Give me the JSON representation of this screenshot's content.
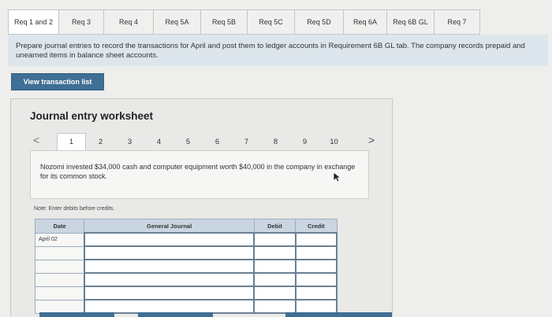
{
  "tabs": [
    {
      "label": "Req 1 and 2",
      "active": true
    },
    {
      "label": "Req 3",
      "active": false
    },
    {
      "label": "Req 4",
      "active": false
    },
    {
      "label": "Req 5A",
      "active": false
    },
    {
      "label": "Req 5B",
      "active": false
    },
    {
      "label": "Req 5C",
      "active": false
    },
    {
      "label": "Req 5D",
      "active": false
    },
    {
      "label": "Req 6A",
      "active": false
    },
    {
      "label": "Req 6B GL",
      "active": false
    },
    {
      "label": "Req 7",
      "active": false
    }
  ],
  "instructions": "Prepare journal entries to record the transactions for April and post them to ledger accounts in Requirement 6B GL tab. The company records prepaid and unearned items in balance sheet accounts.",
  "view_button_label": "View transaction list",
  "worksheet": {
    "title": "Journal entry worksheet",
    "prev_icon": "<",
    "next_icon": ">",
    "pages": [
      "1",
      "2",
      "3",
      "4",
      "5",
      "6",
      "7",
      "8",
      "9",
      "10"
    ],
    "active_page": "1",
    "transaction_text": "Nozomi invested $34,000 cash and computer equipment worth $40,000 in the company in exchange for its common stock.",
    "note": "Note: Enter debits before credits.",
    "table": {
      "headers": {
        "date": "Date",
        "account": "General Journal",
        "debit": "Debit",
        "credit": "Credit"
      },
      "rows": [
        {
          "date": "April 02",
          "account": "",
          "debit": "",
          "credit": ""
        },
        {
          "date": "",
          "account": "",
          "debit": "",
          "credit": ""
        },
        {
          "date": "",
          "account": "",
          "debit": "",
          "credit": ""
        },
        {
          "date": "",
          "account": "",
          "debit": "",
          "credit": ""
        },
        {
          "date": "",
          "account": "",
          "debit": "",
          "credit": ""
        },
        {
          "date": "",
          "account": "",
          "debit": "",
          "credit": ""
        }
      ]
    }
  },
  "colors": {
    "accent": "#3f6f94",
    "banner": "#dde6ec",
    "table_header": "#c9d6e1"
  }
}
